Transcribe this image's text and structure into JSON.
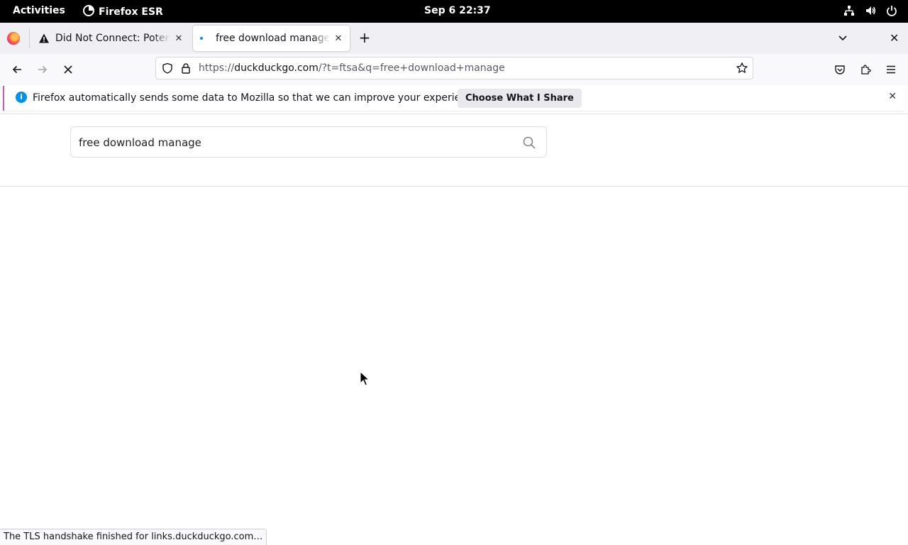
{
  "system_bar": {
    "activities": "Activities",
    "app_name": "Firefox ESR",
    "clock": "Sep 6  22:37"
  },
  "tabs": [
    {
      "title": "Did Not Connect: Potential Security Issue",
      "icon": "warning-icon",
      "active": false
    },
    {
      "title": "free download manage at DuckDuckGo",
      "icon": "loading-dot-icon",
      "active": true
    }
  ],
  "navbar": {
    "url_prefix": "https://",
    "url_host": "duckduckgo.com",
    "url_path": "/?t=ftsa&q=free+download+manage"
  },
  "notification": {
    "message": "Firefox automatically sends some data to Mozilla so that we can improve your experience.",
    "button_label": "Choose What I Share"
  },
  "page": {
    "search_query": "free download manage"
  },
  "status_text": "The TLS handshake finished for links.duckduckgo.com…",
  "colors": {
    "accent_blue": "#0090ed",
    "notification_border": "#c060c0"
  }
}
